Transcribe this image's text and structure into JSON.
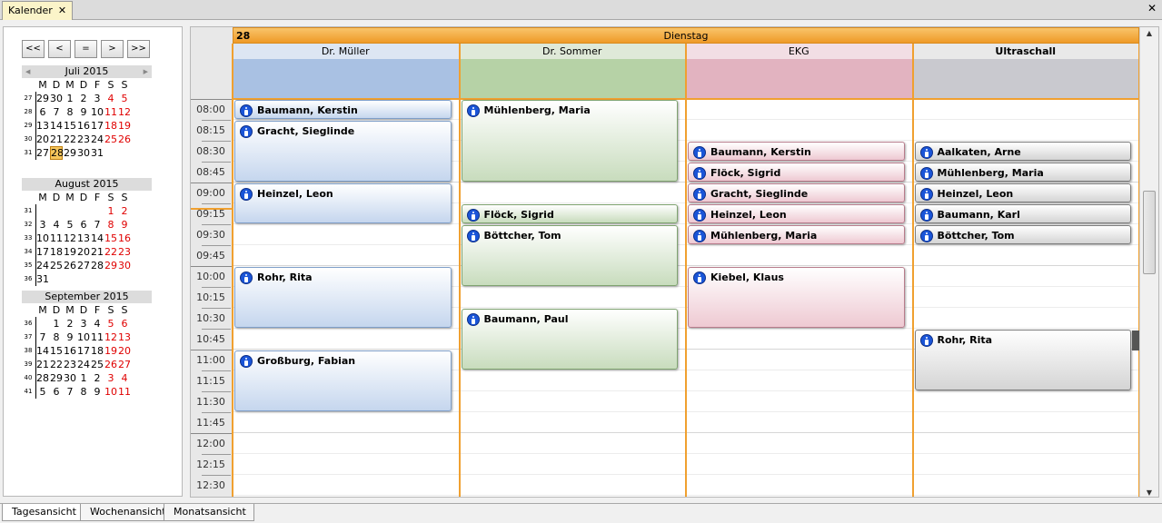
{
  "tab": {
    "title": "Kalender",
    "close": "✕"
  },
  "window_close": "✕",
  "nav": [
    "<<",
    "<",
    "=",
    ">",
    ">>"
  ],
  "weekday_letters": [
    "M",
    "D",
    "M",
    "D",
    "F",
    "S",
    "S"
  ],
  "months": [
    {
      "title": "Juli 2015",
      "weeks": [
        [
          "27",
          "29",
          "30",
          "1",
          "2",
          "3",
          "4",
          "5"
        ],
        [
          "28",
          "6",
          "7",
          "8",
          "9",
          "10",
          "11",
          "12"
        ],
        [
          "29",
          "13",
          "14",
          "15",
          "16",
          "17",
          "18",
          "19"
        ],
        [
          "30",
          "20",
          "21",
          "22",
          "23",
          "24",
          "25",
          "26"
        ],
        [
          "31",
          "27",
          "28",
          "29",
          "30",
          "31",
          "",
          ""
        ]
      ]
    },
    {
      "title": "August 2015",
      "weeks": [
        [
          "31",
          "",
          "",
          "",
          "",
          "",
          "1",
          "2"
        ],
        [
          "32",
          "3",
          "4",
          "5",
          "6",
          "7",
          "8",
          "9"
        ],
        [
          "33",
          "10",
          "11",
          "12",
          "13",
          "14",
          "15",
          "16"
        ],
        [
          "34",
          "17",
          "18",
          "19",
          "20",
          "21",
          "22",
          "23"
        ],
        [
          "35",
          "24",
          "25",
          "26",
          "27",
          "28",
          "29",
          "30"
        ],
        [
          "36",
          "31",
          "",
          "",
          "",
          "",
          "",
          ""
        ]
      ]
    },
    {
      "title": "September 2015",
      "weeks": [
        [
          "36",
          "",
          "1",
          "2",
          "3",
          "4",
          "5",
          "6"
        ],
        [
          "37",
          "7",
          "8",
          "9",
          "10",
          "11",
          "12",
          "13"
        ],
        [
          "38",
          "14",
          "15",
          "16",
          "17",
          "18",
          "19",
          "20"
        ],
        [
          "39",
          "21",
          "22",
          "23",
          "24",
          "25",
          "26",
          "27"
        ],
        [
          "40",
          "28",
          "29",
          "30",
          "1",
          "2",
          "3",
          "4"
        ],
        [
          "41",
          "5",
          "6",
          "7",
          "8",
          "9",
          "10",
          "11"
        ]
      ]
    }
  ],
  "day": {
    "number": "28",
    "name": "Dienstag"
  },
  "times": [
    "08:00",
    "08:15",
    "08:30",
    "08:45",
    "09:00",
    "09:15",
    "09:30",
    "09:45",
    "10:00",
    "10:15",
    "10:30",
    "10:45",
    "11:00",
    "11:15",
    "11:30",
    "11:45",
    "12:00",
    "12:15",
    "12:30"
  ],
  "resources": [
    {
      "name": "Dr. Müller",
      "bold": false,
      "head_color": "#dde6f3",
      "strip_color": "#a9c1e3",
      "appt_style": "blue"
    },
    {
      "name": "Dr. Sommer",
      "bold": false,
      "head_color": "#dfe9d8",
      "strip_color": "#b6d2a6",
      "appt_style": "green"
    },
    {
      "name": "EKG",
      "bold": false,
      "head_color": "#f2dee4",
      "strip_color": "#e2b3c0",
      "appt_style": "pink"
    },
    {
      "name": "Ultraschall",
      "bold": true,
      "head_color": "#e9e9e9",
      "strip_color": "#c9c9cf",
      "appt_style": "gray"
    }
  ],
  "appointments": [
    {
      "res": 0,
      "name": "Baumann, Kerstin",
      "start": "08:00",
      "end": "08:15"
    },
    {
      "res": 0,
      "name": "Gracht, Sieglinde",
      "start": "08:15",
      "end": "09:00"
    },
    {
      "res": 0,
      "name": "Heinzel, Leon",
      "start": "09:00",
      "end": "09:30"
    },
    {
      "res": 0,
      "name": "Rohr, Rita",
      "start": "10:00",
      "end": "10:45"
    },
    {
      "res": 0,
      "name": "Großburg, Fabian",
      "start": "11:00",
      "end": "11:45"
    },
    {
      "res": 1,
      "name": "Mühlenberg, Maria",
      "start": "08:00",
      "end": "09:00"
    },
    {
      "res": 1,
      "name": "Flöck, Sigrid",
      "start": "09:15",
      "end": "09:30"
    },
    {
      "res": 1,
      "name": "Böttcher, Tom",
      "start": "09:30",
      "end": "10:15"
    },
    {
      "res": 1,
      "name": "Baumann, Paul",
      "start": "10:30",
      "end": "11:15"
    },
    {
      "res": 2,
      "name": "Baumann, Kerstin",
      "start": "08:30",
      "end": "08:45"
    },
    {
      "res": 2,
      "name": "Flöck, Sigrid",
      "start": "08:45",
      "end": "09:00"
    },
    {
      "res": 2,
      "name": "Gracht, Sieglinde",
      "start": "09:00",
      "end": "09:15"
    },
    {
      "res": 2,
      "name": "Heinzel, Leon",
      "start": "09:15",
      "end": "09:30"
    },
    {
      "res": 2,
      "name": "Mühlenberg, Maria",
      "start": "09:30",
      "end": "09:45"
    },
    {
      "res": 2,
      "name": "Kiebel, Klaus",
      "start": "10:00",
      "end": "10:45"
    },
    {
      "res": 3,
      "name": "Aalkaten, Arne",
      "start": "08:30",
      "end": "08:45"
    },
    {
      "res": 3,
      "name": "Mühlenberg, Maria",
      "start": "08:45",
      "end": "09:00"
    },
    {
      "res": 3,
      "name": "Heinzel, Leon",
      "start": "09:00",
      "end": "09:15"
    },
    {
      "res": 3,
      "name": "Baumann, Karl",
      "start": "09:15",
      "end": "09:30"
    },
    {
      "res": 3,
      "name": "Böttcher, Tom",
      "start": "09:30",
      "end": "09:45"
    },
    {
      "res": 3,
      "name": "Rohr, Rita",
      "start": "10:45",
      "end": "11:30"
    }
  ],
  "view_tabs": [
    "Tagesansicht",
    "Wochenansicht",
    "Monatsansicht"
  ],
  "scroll": {
    "up": "▲",
    "down": "▼",
    "grip": "≡"
  },
  "month_arrows": {
    "prev": "◀",
    "next": "▶"
  }
}
